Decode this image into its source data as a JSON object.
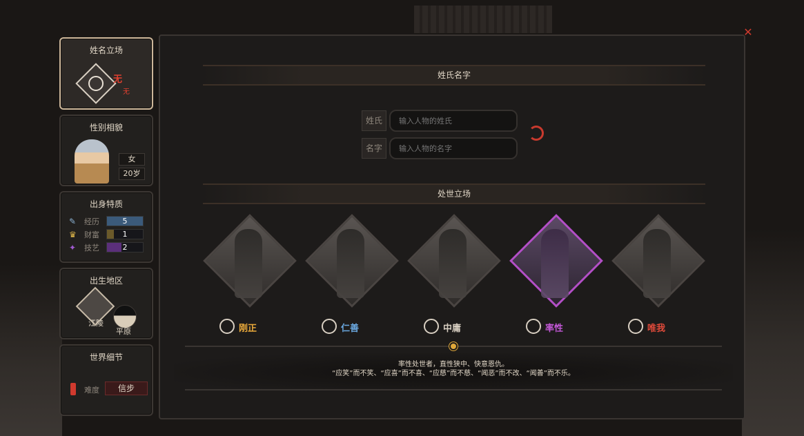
{
  "sidebar": {
    "name_stance": {
      "title": "姓名立场",
      "stance": "无",
      "stance_sub": "无"
    },
    "gender_looks": {
      "title": "性别相貌",
      "gender": "女",
      "age": "20岁"
    },
    "origin_traits": {
      "title": "出身特质",
      "stats": [
        {
          "label": "经历",
          "value": "5",
          "color": "#3b5a7a",
          "fill": 1.0,
          "icon": "feather-icon"
        },
        {
          "label": "财富",
          "value": "1",
          "color": "#6b5a2a",
          "fill": 0.2,
          "icon": "gold-icon"
        },
        {
          "label": "技艺",
          "value": "2",
          "color": "#5b2f7a",
          "fill": 0.4,
          "icon": "skill-icon"
        }
      ]
    },
    "birth_region": {
      "title": "出生地区",
      "city": "江陵",
      "terrain": "平原"
    },
    "world_details": {
      "title": "世界细节",
      "difficulty_label": "难度",
      "difficulty_value": "信步"
    }
  },
  "main": {
    "name_section_title": "姓氏名字",
    "surname_label": "姓氏",
    "surname_placeholder": "输入人物的姓氏",
    "given_name_label": "名字",
    "given_name_placeholder": "输入人物的名字",
    "stance_section_title": "处世立场",
    "stances": [
      {
        "label": "刚正",
        "color": "#e8a83a",
        "selected": false
      },
      {
        "label": "仁善",
        "color": "#6aa8e0",
        "selected": false
      },
      {
        "label": "中庸",
        "color": "#d8cfc2",
        "selected": false
      },
      {
        "label": "率性",
        "color": "#c458d8",
        "selected": true
      },
      {
        "label": "唯我",
        "color": "#e04a3a",
        "selected": false
      }
    ],
    "description_line1": "率性处世者，直性狭中、快意恩仇。",
    "description_line2": "“应笑”而不笑、“应喜”而不喜、“应慈”而不慈、“闻恶”而不改、“闻善”而不乐。"
  },
  "close_icon": "close-icon"
}
